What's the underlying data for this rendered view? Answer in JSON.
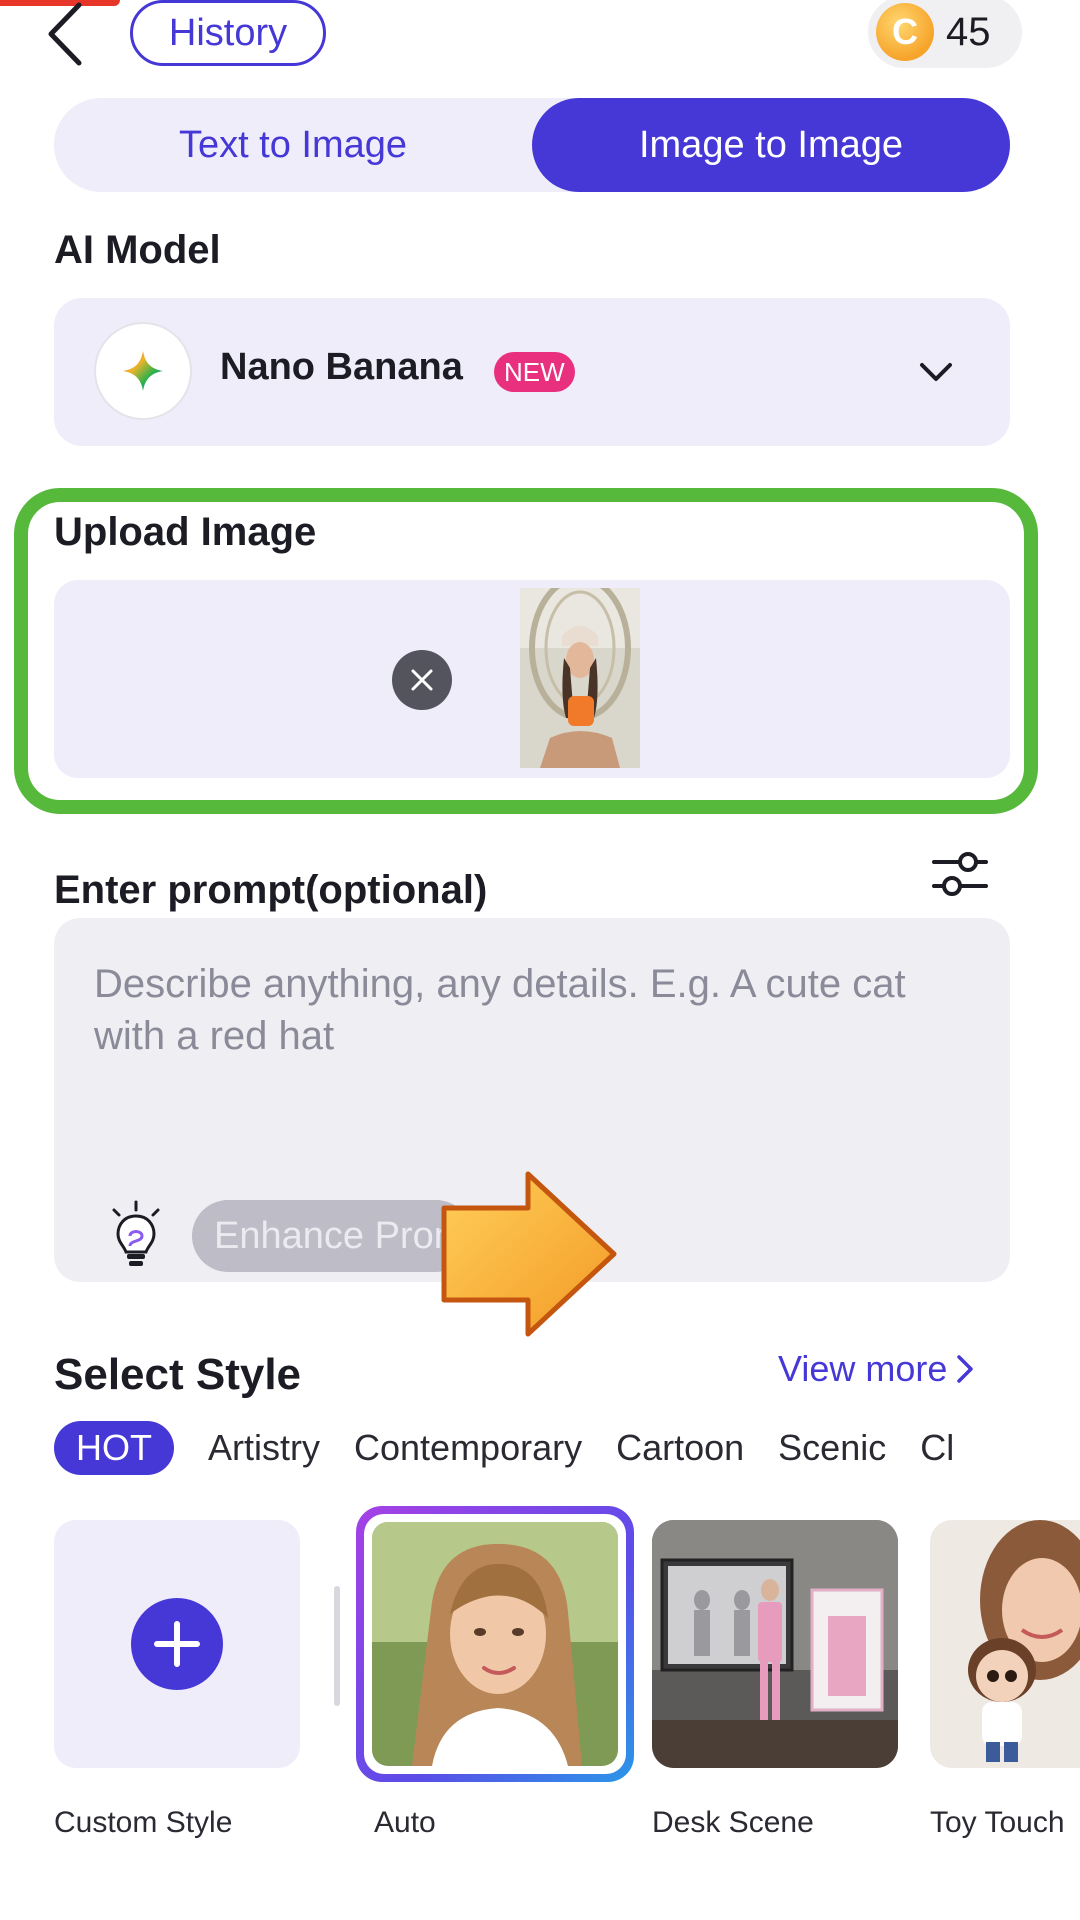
{
  "header": {
    "history_label": "History",
    "coin_symbol": "C",
    "coin_count": "45"
  },
  "mode_tabs": {
    "text_to_image": "Text to Image",
    "image_to_image": "Image to Image",
    "active": "Image to Image"
  },
  "ai_model": {
    "section_title": "AI Model",
    "name": "Nano Banana",
    "badge": "NEW"
  },
  "upload": {
    "section_title": "Upload Image"
  },
  "prompt": {
    "section_title": "Enter prompt(optional)",
    "placeholder": "Describe anything, any details. E.g. A cute cat with a red hat",
    "enhance_label": "Enhance Prompt"
  },
  "styles": {
    "section_title": "Select Style",
    "view_more": "View more",
    "categories": [
      "HOT",
      "Artistry",
      "Contemporary",
      "Cartoon",
      "Scenic",
      "Cl"
    ],
    "active_category": "HOT",
    "cards": [
      {
        "label": "Custom Style"
      },
      {
        "label": "Auto"
      },
      {
        "label": "Desk Scene"
      },
      {
        "label": "Toy Touch"
      }
    ]
  },
  "colors": {
    "accent": "#4538d6",
    "highlight_frame": "#57b93b",
    "new_badge": "#e8307f"
  }
}
